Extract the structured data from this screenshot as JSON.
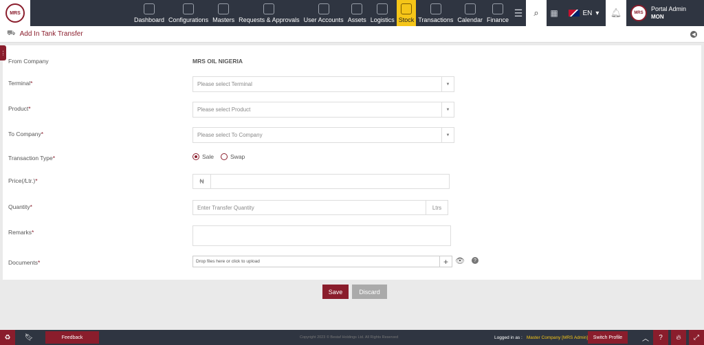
{
  "brand": {
    "logo_text": "MRS"
  },
  "nav": [
    {
      "label": "Dashboard",
      "icon": "dashboard-icon"
    },
    {
      "label": "Configurations",
      "icon": "gears-icon"
    },
    {
      "label": "Masters",
      "icon": "masters-icon"
    },
    {
      "label": "Requests & Approvals",
      "icon": "requests-icon"
    },
    {
      "label": "User Accounts",
      "icon": "users-icon"
    },
    {
      "label": "Assets",
      "icon": "assets-icon"
    },
    {
      "label": "Logistics",
      "icon": "logistics-icon"
    },
    {
      "label": "Stock",
      "icon": "stock-icon",
      "active": true
    },
    {
      "label": "Transactions",
      "icon": "transactions-icon"
    },
    {
      "label": "Calendar",
      "icon": "calendar-icon"
    },
    {
      "label": "Finance",
      "icon": "finance-icon"
    }
  ],
  "header": {
    "language": "EN",
    "user_name": "Portal Admin",
    "user_sub": "MON",
    "avatar_text": "MRS"
  },
  "page": {
    "title": "Add In Tank Transfer"
  },
  "form": {
    "from_company": {
      "label": "From Company",
      "value": "MRS OIL NIGERIA"
    },
    "terminal": {
      "label": "Terminal",
      "placeholder": "Please select Terminal"
    },
    "product": {
      "label": "Product",
      "placeholder": "Please select Product"
    },
    "to_company": {
      "label": "To Company",
      "placeholder": "Please select To Company"
    },
    "transaction_type": {
      "label": "Transaction Type",
      "options": [
        "Sale",
        "Swap"
      ],
      "selected": "Sale"
    },
    "price": {
      "label": "Price(/Ltr.)",
      "currency": "₦",
      "value": ""
    },
    "quantity": {
      "label": "Quantity",
      "placeholder": "Enter Transfer Quantity",
      "unit": "Ltrs"
    },
    "remarks": {
      "label": "Remarks",
      "value": ""
    },
    "documents": {
      "label": "Documents",
      "placeholder": "Drop files here or click to upload"
    },
    "required_mark": "*"
  },
  "actions": {
    "save": "Save",
    "discard": "Discard"
  },
  "footer": {
    "feedback": "Feedback",
    "copyright": "Copyright 2023 © Bestaf Holdings Ltd. All Rights Reserved",
    "logged_in_label": "Logged in as :",
    "logged_in_company": "Master Company [MRS Admin]",
    "switch_profile": "Switch Profile"
  }
}
